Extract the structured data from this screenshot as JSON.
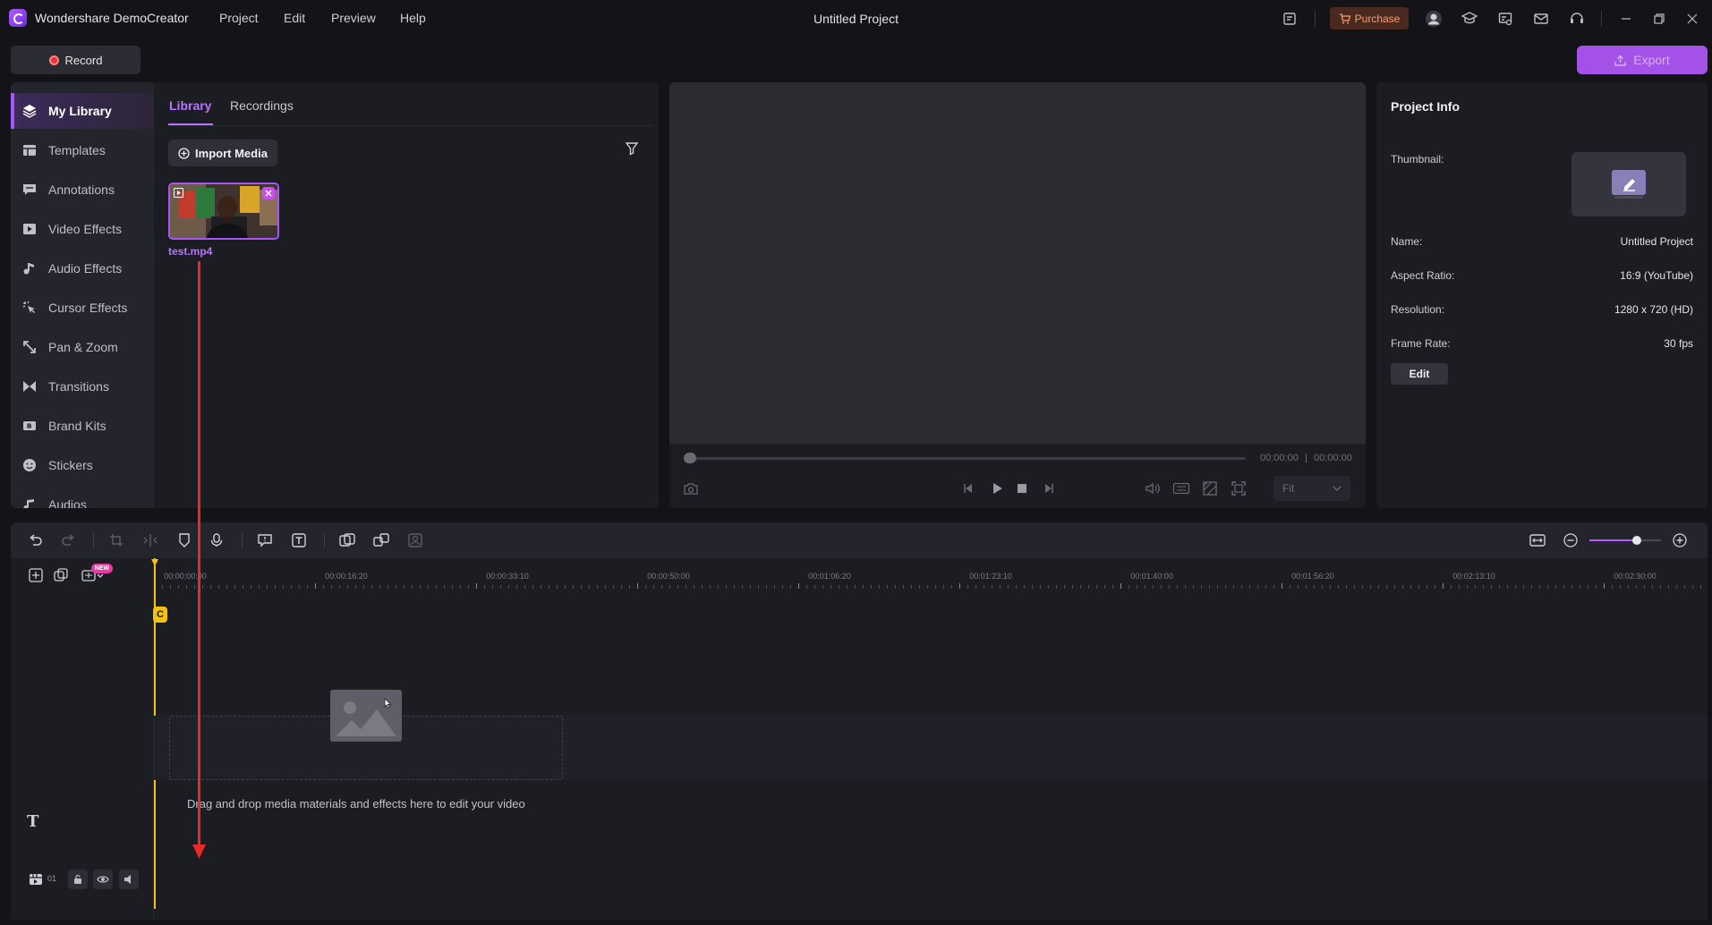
{
  "app": {
    "name": "Wondershare DemoCreator",
    "project_title": "Untitled Project"
  },
  "menu": [
    "Project",
    "Edit",
    "Preview",
    "Help"
  ],
  "titlebar": {
    "purchase_label": "Purchase",
    "icons": [
      "notes-icon",
      "purchase-cart-icon",
      "account-icon",
      "tutorial-icon",
      "screenshot-icon",
      "mail-icon",
      "support-icon",
      "minimize-icon",
      "restore-icon",
      "close-icon"
    ]
  },
  "toolbar": {
    "record_label": "Record",
    "export_label": "Export"
  },
  "sidebar": {
    "items": [
      {
        "label": "My Library",
        "icon": "layers-icon",
        "active": true
      },
      {
        "label": "Templates",
        "icon": "templates-icon"
      },
      {
        "label": "Annotations",
        "icon": "annotation-icon"
      },
      {
        "label": "Video Effects",
        "icon": "video-effects-icon"
      },
      {
        "label": "Audio Effects",
        "icon": "music-note-icon"
      },
      {
        "label": "Cursor Effects",
        "icon": "cursor-icon"
      },
      {
        "label": "Pan & Zoom",
        "icon": "pan-zoom-icon"
      },
      {
        "label": "Transitions",
        "icon": "transition-icon"
      },
      {
        "label": "Brand Kits",
        "icon": "brand-kit-icon"
      },
      {
        "label": "Stickers",
        "icon": "sticker-icon"
      },
      {
        "label": "Audios",
        "icon": "audio-icon"
      }
    ]
  },
  "library": {
    "tabs": [
      "Library",
      "Recordings"
    ],
    "import_label": "Import Media",
    "media": [
      {
        "filename": "test.mp4"
      }
    ]
  },
  "preview": {
    "time_current": "00:00:00",
    "time_separator": "|",
    "time_total": "00:00:00",
    "fit_option": "Fit"
  },
  "project_info": {
    "title": "Project Info",
    "thumbnail_label": "Thumbnail:",
    "rows": [
      {
        "label": "Name:",
        "value": "Untitled Project"
      },
      {
        "label": "Aspect Ratio:",
        "value": "16:9 (YouTube)"
      },
      {
        "label": "Resolution:",
        "value": "1280 x 720 (HD)"
      },
      {
        "label": "Frame Rate:",
        "value": "30 fps"
      }
    ],
    "edit_label": "Edit"
  },
  "timeline": {
    "new_badge": "NEW",
    "ruler_labels": [
      "00:00:00:00",
      "00:00:16:20",
      "00:00:33:10",
      "00:00:50:00",
      "00:01:06:20",
      "00:01:23:10",
      "00:01:40:00",
      "00:01:56:20",
      "00:02:13:10",
      "00:02:30:00"
    ],
    "playhead_marker": "C",
    "drop_hint": "Drag and drop media materials and effects here to edit your video",
    "text_track_icon": "T",
    "track_number": "01",
    "zoom_level": 0.66
  },
  "colors": {
    "accent": "#b459ff",
    "playhead": "#f3c014",
    "annotation_arrow": "#e52a2a"
  }
}
